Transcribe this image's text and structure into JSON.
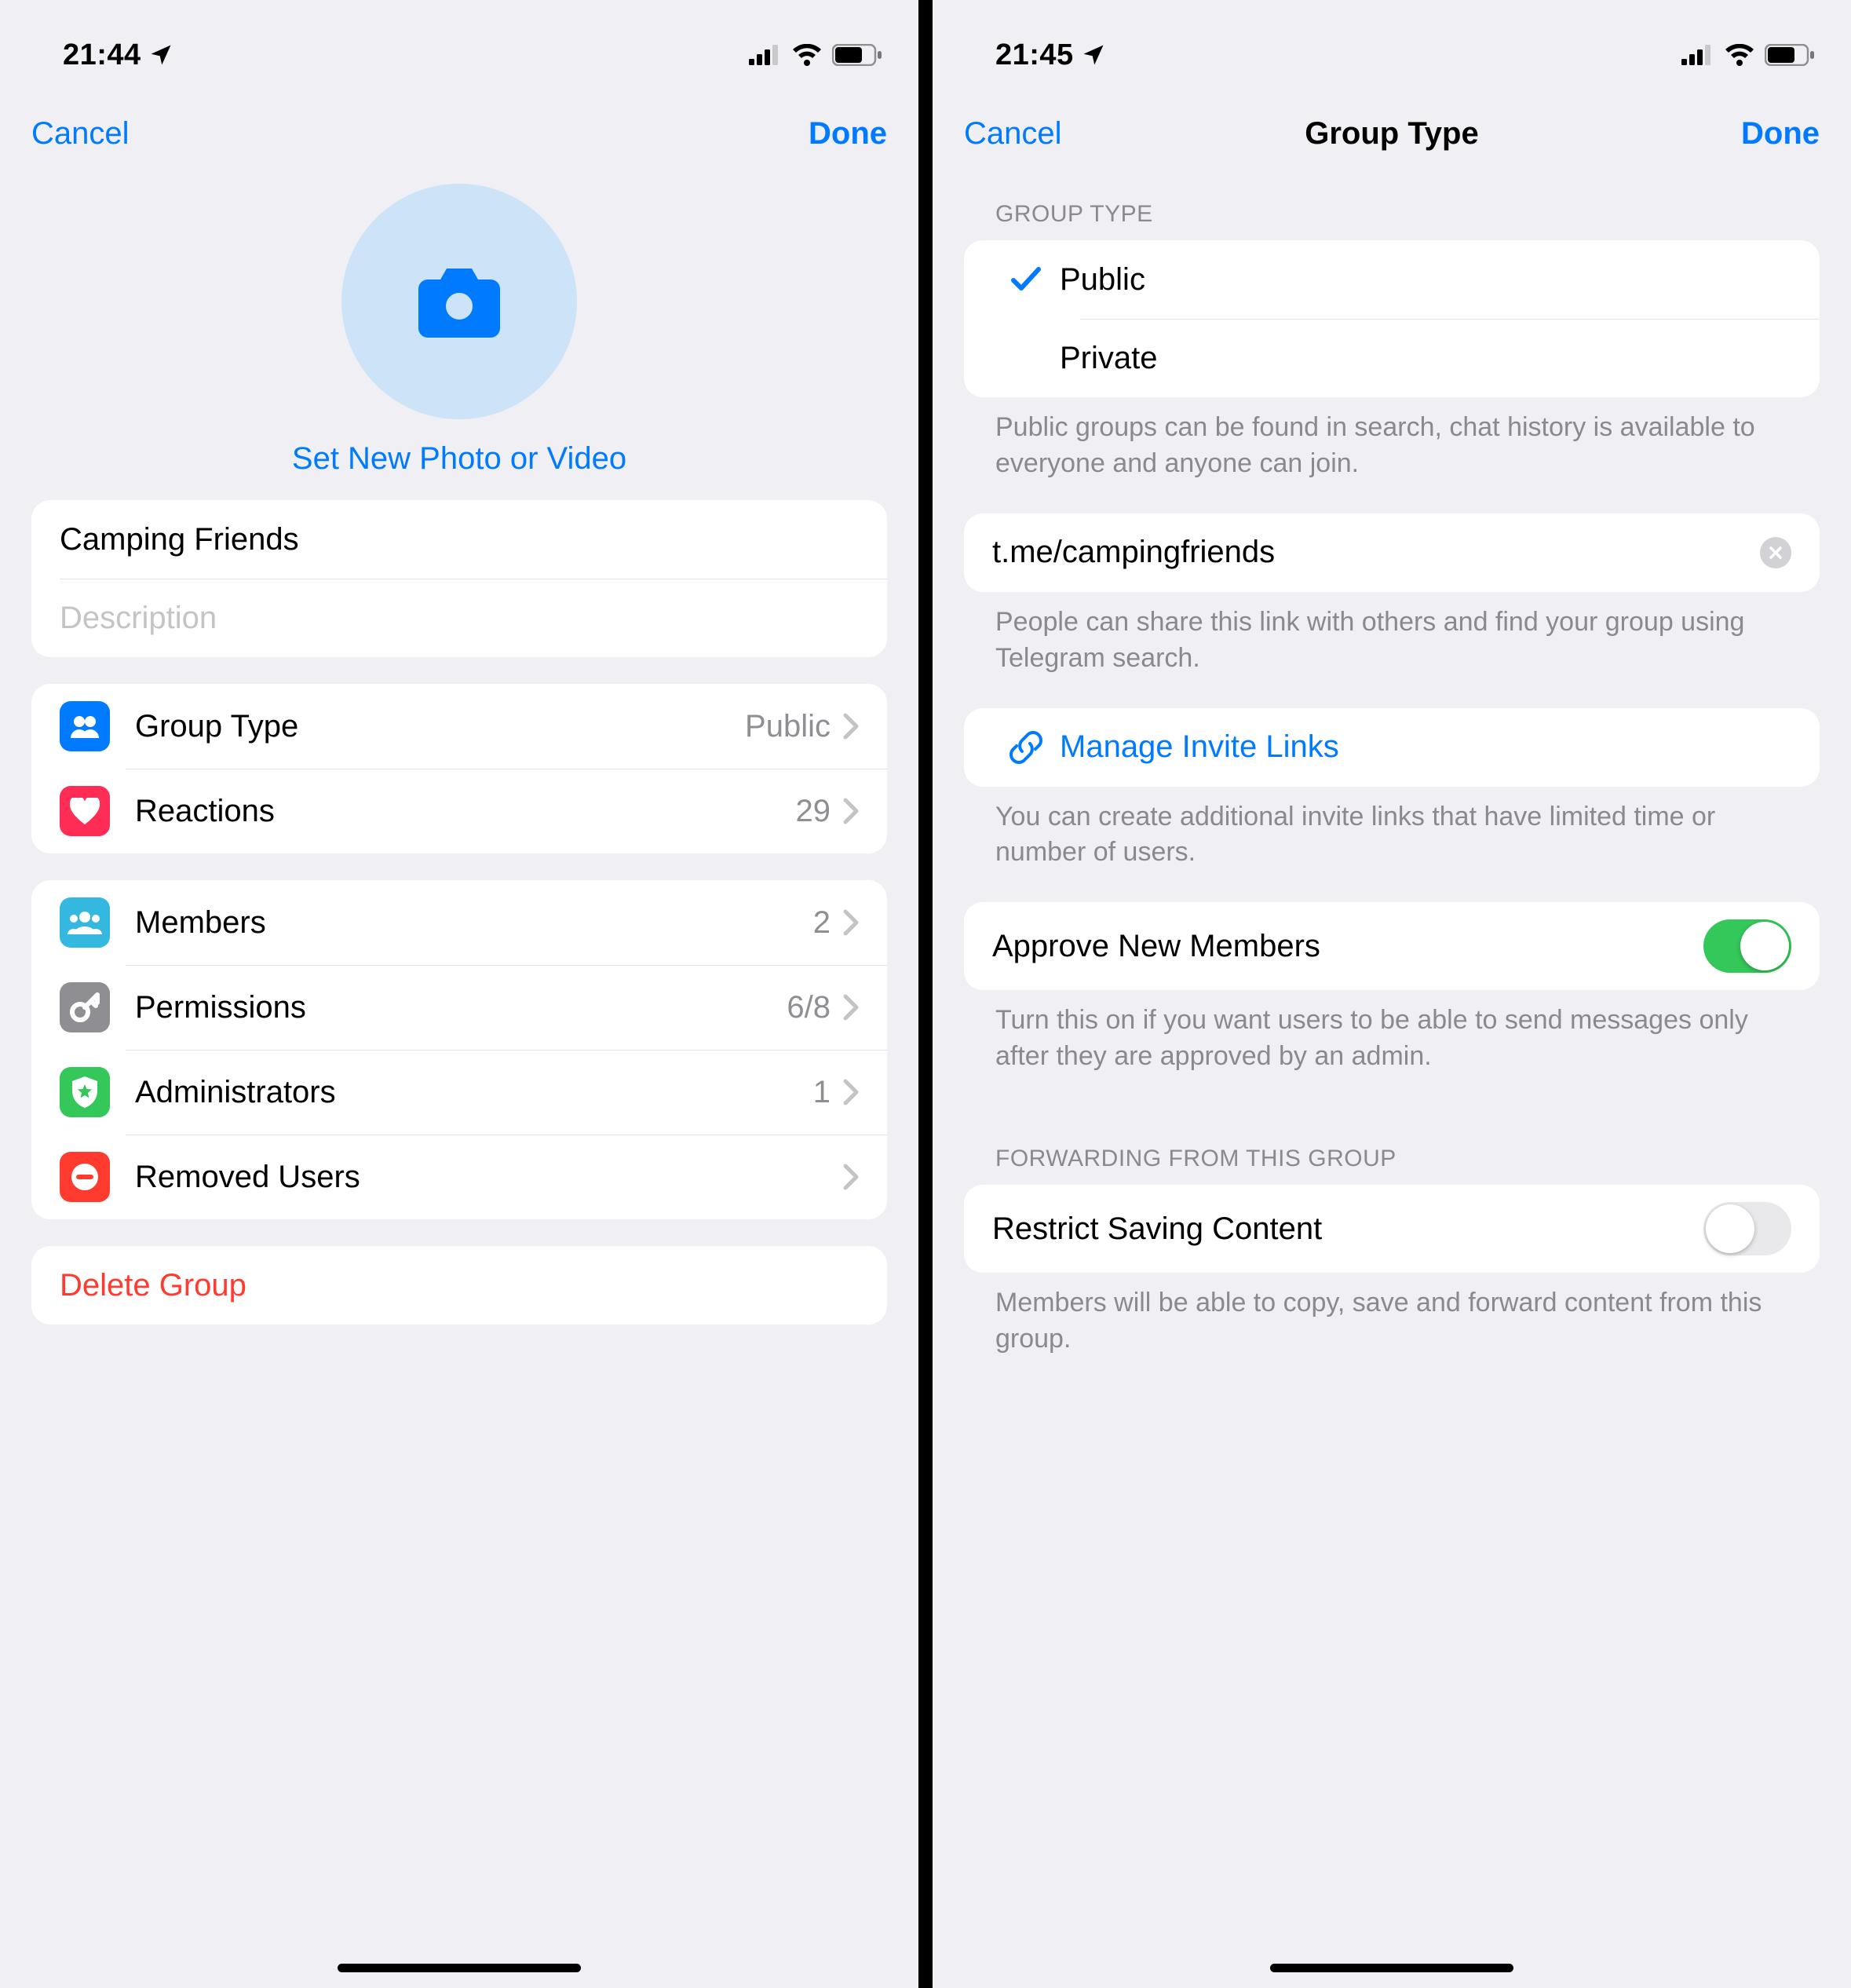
{
  "left": {
    "status": {
      "time": "21:44"
    },
    "nav": {
      "cancel": "Cancel",
      "done": "Done"
    },
    "avatar": {
      "set_photo": "Set New Photo or Video"
    },
    "name_field": {
      "value": "Camping Friends"
    },
    "description_field": {
      "placeholder": "Description"
    },
    "rows1": {
      "group_type": {
        "label": "Group Type",
        "value": "Public"
      },
      "reactions": {
        "label": "Reactions",
        "value": "29"
      }
    },
    "rows2": {
      "members": {
        "label": "Members",
        "value": "2"
      },
      "permissions": {
        "label": "Permissions",
        "value": "6/8"
      },
      "administrators": {
        "label": "Administrators",
        "value": "1"
      },
      "removed_users": {
        "label": "Removed Users",
        "value": ""
      }
    },
    "delete": {
      "label": "Delete Group"
    }
  },
  "right": {
    "status": {
      "time": "21:45"
    },
    "nav": {
      "cancel": "Cancel",
      "title": "Group Type",
      "done": "Done"
    },
    "type_section": {
      "header": "GROUP TYPE",
      "public": "Public",
      "private": "Private",
      "footer": "Public groups can be found in search, chat history is available to everyone and anyone can join."
    },
    "link_section": {
      "link": "t.me/campingfriends",
      "footer": "People can share this link with others and find your group using Telegram search."
    },
    "invite_section": {
      "label": "Manage Invite Links",
      "footer": "You can create additional invite links that have limited time or number of users."
    },
    "approve_section": {
      "label": "Approve New Members",
      "footer": "Turn this on if you want users to be able to send messages only after they are approved by an admin."
    },
    "forward_section": {
      "header": "FORWARDING FROM THIS GROUP",
      "label": "Restrict Saving Content",
      "footer": "Members will be able to copy, save and forward content from this group."
    }
  }
}
